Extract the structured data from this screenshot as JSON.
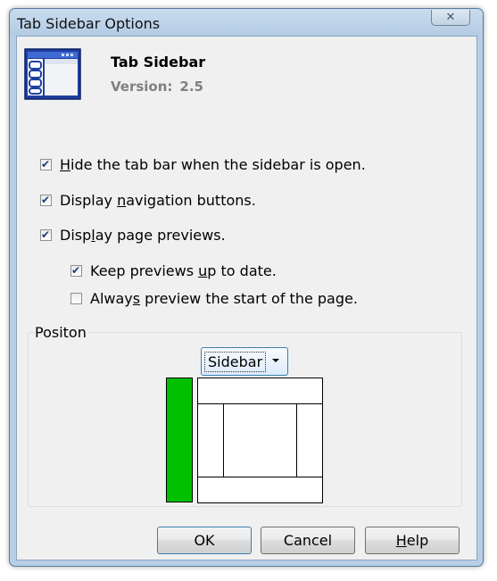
{
  "window": {
    "title": "Tab Sidebar Options",
    "close_symbol": "✕"
  },
  "header": {
    "app_name": "Tab Sidebar",
    "version_label": "Version:",
    "version_value": "2.5",
    "icon": "window-with-sidebar-icon"
  },
  "options": [
    {
      "pre": "",
      "accel": "H",
      "post": "ide the tab bar when the sidebar is open.",
      "checked": true
    },
    {
      "pre": "Display ",
      "accel": "n",
      "post": "avigation buttons.",
      "checked": true
    },
    {
      "pre": "Disp",
      "accel": "l",
      "post": "ay page previews.",
      "checked": true
    },
    {
      "pre": "Keep previews ",
      "accel": "u",
      "post": "p to date.",
      "checked": true
    },
    {
      "pre": "Alway",
      "accel": "s",
      "post": " preview the start of the page.",
      "checked": false
    }
  ],
  "position_group": {
    "label": "Positon",
    "selected": "Sidebar",
    "sidebar_color": "#00c000"
  },
  "buttons": {
    "ok": "OK",
    "cancel": "Cancel",
    "help_accel": "H",
    "help_rest": "elp"
  }
}
